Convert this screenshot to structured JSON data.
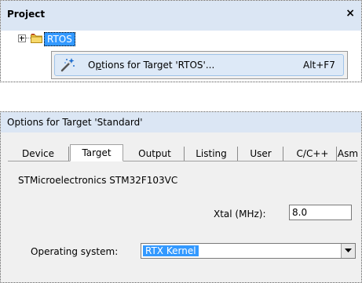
{
  "project": {
    "title": "Project",
    "close_symbol": "×",
    "tree_item": "RTOS"
  },
  "context_menu": {
    "label_prefix": "O",
    "label_underlined": "p",
    "label_rest": "tions for Target 'RTOS'...",
    "shortcut": "Alt+F7",
    "icon": "magic-wand-icon"
  },
  "dialog": {
    "title": "Options for Target 'Standard'",
    "tabs": [
      "Device",
      "Target",
      "Output",
      "Listing",
      "User",
      "C/C++",
      "Asm"
    ],
    "active_tab": "Target",
    "device_name": "STMicroelectronics STM32F103VC",
    "xtal_label": "Xtal (MHz):",
    "xtal_value": "8.0",
    "os_label": "Operating system:",
    "os_value": "RTX Kernel"
  },
  "colors": {
    "title_bar": "#dbe6f4",
    "selection": "#3399ff",
    "menu_hover": "#dde9f7",
    "dialog_face": "#f0f0f0"
  }
}
